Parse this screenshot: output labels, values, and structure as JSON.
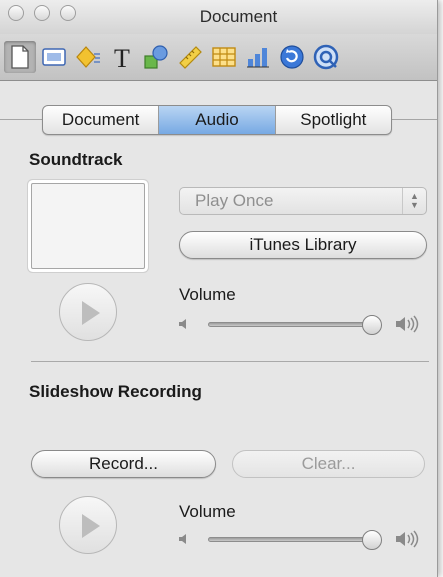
{
  "window": {
    "title": "Document"
  },
  "toolbar": {
    "icons": [
      "document-icon",
      "slide-icon",
      "build-icon",
      "text-icon",
      "shapes-icon",
      "metrics-icon",
      "table-icon",
      "chart-icon",
      "hyperlink-icon",
      "quicktime-icon"
    ],
    "selected": "document-icon",
    "text_glyph": "T"
  },
  "tabs": {
    "items": [
      "Document",
      "Audio",
      "Spotlight"
    ],
    "active": "Audio"
  },
  "soundtrack": {
    "heading": "Soundtrack",
    "play_mode": "Play Once",
    "itunes_button": "iTunes Library",
    "volume_label": "Volume",
    "volume_level": 0.95
  },
  "recording": {
    "heading": "Slideshow Recording",
    "record_button": "Record...",
    "clear_button": "Clear...",
    "volume_label": "Volume",
    "volume_level": 0.95
  }
}
